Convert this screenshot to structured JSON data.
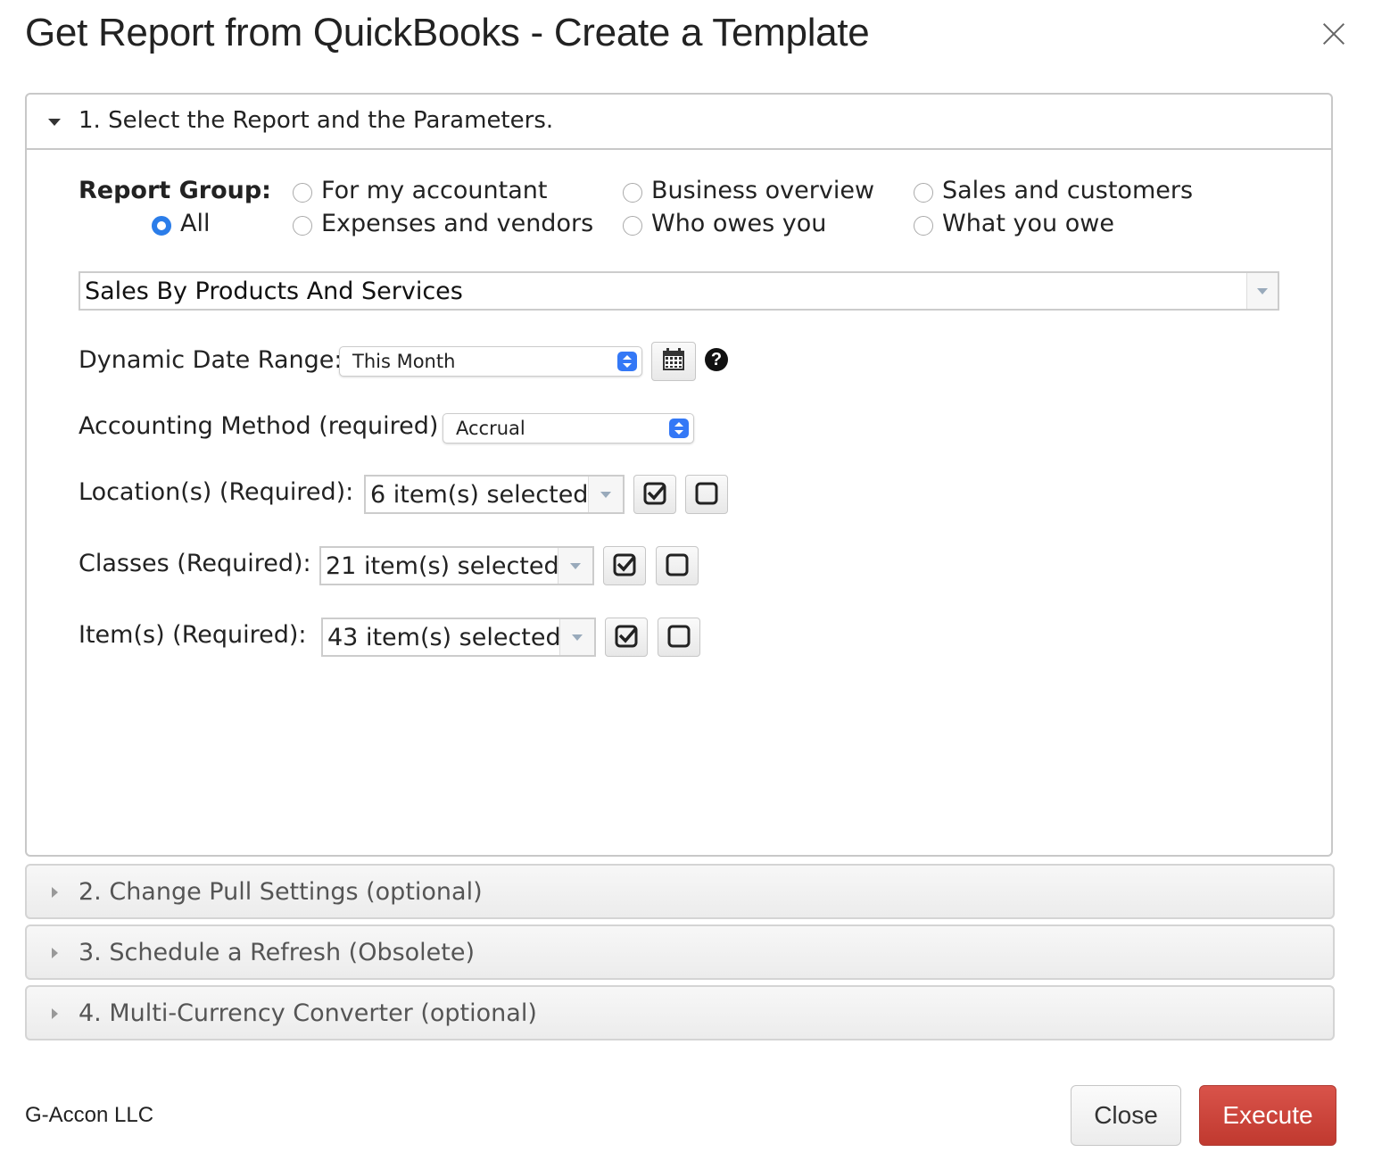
{
  "dialog": {
    "title": "Get Report from QuickBooks - Create a Template"
  },
  "section1": {
    "header": "1. Select the Report and the Parameters.",
    "report_group_label": "Report Group:",
    "report_groups": [
      {
        "label": "All",
        "selected": true
      },
      {
        "label": "For my accountant",
        "selected": false
      },
      {
        "label": "Expenses and vendors",
        "selected": false
      },
      {
        "label": "Business overview",
        "selected": false
      },
      {
        "label": "Who owes you",
        "selected": false
      },
      {
        "label": "Sales and customers",
        "selected": false
      },
      {
        "label": "What you owe",
        "selected": false
      }
    ],
    "report_select": "Sales By Products And Services",
    "date_range": {
      "label": "Dynamic Date Range:",
      "value": "This Month"
    },
    "help_glyph": "?",
    "accounting_method": {
      "label": "Accounting Method (required)",
      "value": "Accrual"
    },
    "locations": {
      "label": "Location(s) (Required):",
      "value": "6 item(s) selected"
    },
    "classes": {
      "label": "Classes (Required):",
      "value": "21 item(s) selected"
    },
    "items": {
      "label": "Item(s) (Required):",
      "value": "43 item(s) selected"
    }
  },
  "sections": [
    {
      "label": "2. Change Pull Settings (optional)"
    },
    {
      "label": "3. Schedule a Refresh (Obsolete)"
    },
    {
      "label": "4. Multi-Currency Converter (optional)"
    }
  ],
  "footer": {
    "brand": "G-Accon LLC",
    "close_label": "Close",
    "execute_label": "Execute"
  },
  "colors": {
    "accent": "#2b7de9",
    "execute": "#c9443b"
  }
}
